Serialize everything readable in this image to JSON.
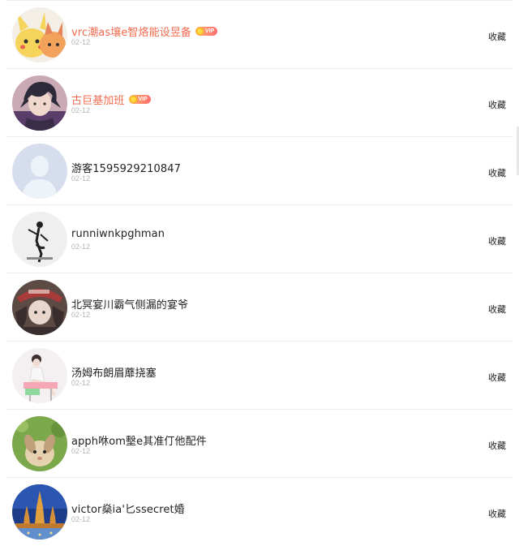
{
  "list": {
    "items": [
      {
        "name": "vrc潮as壤e智烙能设昱备",
        "vip": true,
        "vip_label": "VIP",
        "date": "02-12",
        "action": "收藏",
        "avatar_icon": "pikachu-avatar-icon",
        "avatar_colors": [
          "#f6d35b",
          "#f2a25a",
          "#e8845b"
        ]
      },
      {
        "name": "古巨基加班",
        "vip": true,
        "vip_label": "VIP",
        "date": "02-12",
        "action": "收藏",
        "avatar_icon": "anime-character-avatar-icon",
        "avatar_colors": [
          "#2d2a3a",
          "#5a3d6a",
          "#c9a9b3"
        ]
      },
      {
        "name": "游客1595929210847",
        "vip": false,
        "date": "02-12",
        "action": "收藏",
        "avatar_icon": "default-user-avatar-icon",
        "avatar_colors": [
          "#d6deee",
          "#eef2f9"
        ]
      },
      {
        "name": "runniwnkpghman",
        "vip": false,
        "date": "02-12",
        "action": "收藏",
        "avatar_icon": "dancer-avatar-icon",
        "avatar_colors": [
          "#efefef",
          "#222222"
        ]
      },
      {
        "name": "北冥宴川霸气侧漏的宴爷",
        "vip": false,
        "date": "02-12",
        "action": "收藏",
        "avatar_icon": "character-with-hat-avatar-icon",
        "avatar_colors": [
          "#3a2d2d",
          "#a83a3a",
          "#e8d6cc"
        ]
      },
      {
        "name": "汤姆布朗眉蘼挠塞",
        "vip": false,
        "date": "02-12",
        "action": "收藏",
        "avatar_icon": "girl-sitting-avatar-icon",
        "avatar_colors": [
          "#f4f0f2",
          "#f5a7b6",
          "#8fd89b"
        ]
      },
      {
        "name": "apph咻om墼e其准仃他配件",
        "vip": false,
        "date": "02-12",
        "action": "收藏",
        "avatar_icon": "rabbit-avatar-icon",
        "avatar_colors": [
          "#7aa84a",
          "#e6d2b0",
          "#bfa07a"
        ]
      },
      {
        "name": "victor燊ia'匕ssecret婚",
        "vip": false,
        "date": "02-12",
        "action": "收藏",
        "avatar_icon": "temple-night-avatar-icon",
        "avatar_colors": [
          "#1d3d8a",
          "#e0a040",
          "#7fb0e8"
        ]
      }
    ]
  }
}
